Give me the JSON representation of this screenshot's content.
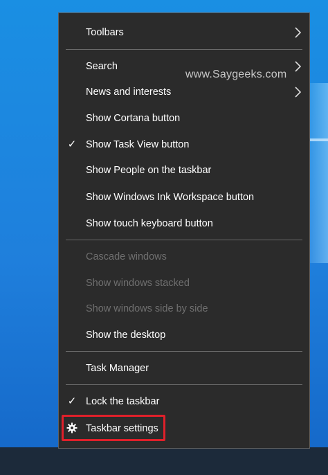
{
  "menu": {
    "items": [
      {
        "label": "Toolbars",
        "submenu": true,
        "checked": false,
        "disabled": false,
        "icon": "chevron-right-icon"
      },
      {
        "label": "Search",
        "submenu": true,
        "checked": false,
        "disabled": false,
        "icon": "chevron-right-icon"
      },
      {
        "label": "News and interests",
        "submenu": true,
        "checked": false,
        "disabled": false,
        "icon": "chevron-right-icon"
      },
      {
        "label": "Show Cortana button",
        "submenu": false,
        "checked": false,
        "disabled": false
      },
      {
        "label": "Show Task View button",
        "submenu": false,
        "checked": true,
        "disabled": false
      },
      {
        "label": "Show People on the taskbar",
        "submenu": false,
        "checked": false,
        "disabled": false
      },
      {
        "label": "Show Windows Ink Workspace button",
        "submenu": false,
        "checked": false,
        "disabled": false
      },
      {
        "label": "Show touch keyboard button",
        "submenu": false,
        "checked": false,
        "disabled": false
      },
      {
        "label": "Cascade windows",
        "submenu": false,
        "checked": false,
        "disabled": true
      },
      {
        "label": "Show windows stacked",
        "submenu": false,
        "checked": false,
        "disabled": true
      },
      {
        "label": "Show windows side by side",
        "submenu": false,
        "checked": false,
        "disabled": true
      },
      {
        "label": "Show the desktop",
        "submenu": false,
        "checked": false,
        "disabled": false
      },
      {
        "label": "Task Manager",
        "submenu": false,
        "checked": false,
        "disabled": false
      },
      {
        "label": "Lock the taskbar",
        "submenu": false,
        "checked": true,
        "disabled": false
      },
      {
        "label": "Taskbar settings",
        "submenu": false,
        "checked": false,
        "disabled": false,
        "icon": "gear-icon",
        "highlighted": true
      }
    ],
    "check_glyph": "✓"
  },
  "watermark": "www.Saygeeks.com",
  "colors": {
    "menu_bg": "#2b2b2b",
    "text": "#ffffff",
    "disabled_text": "#6f6f6f",
    "separator": "#6a6a6a",
    "highlight_border": "#e0202a",
    "desktop_blue": "#1a8fe3"
  }
}
